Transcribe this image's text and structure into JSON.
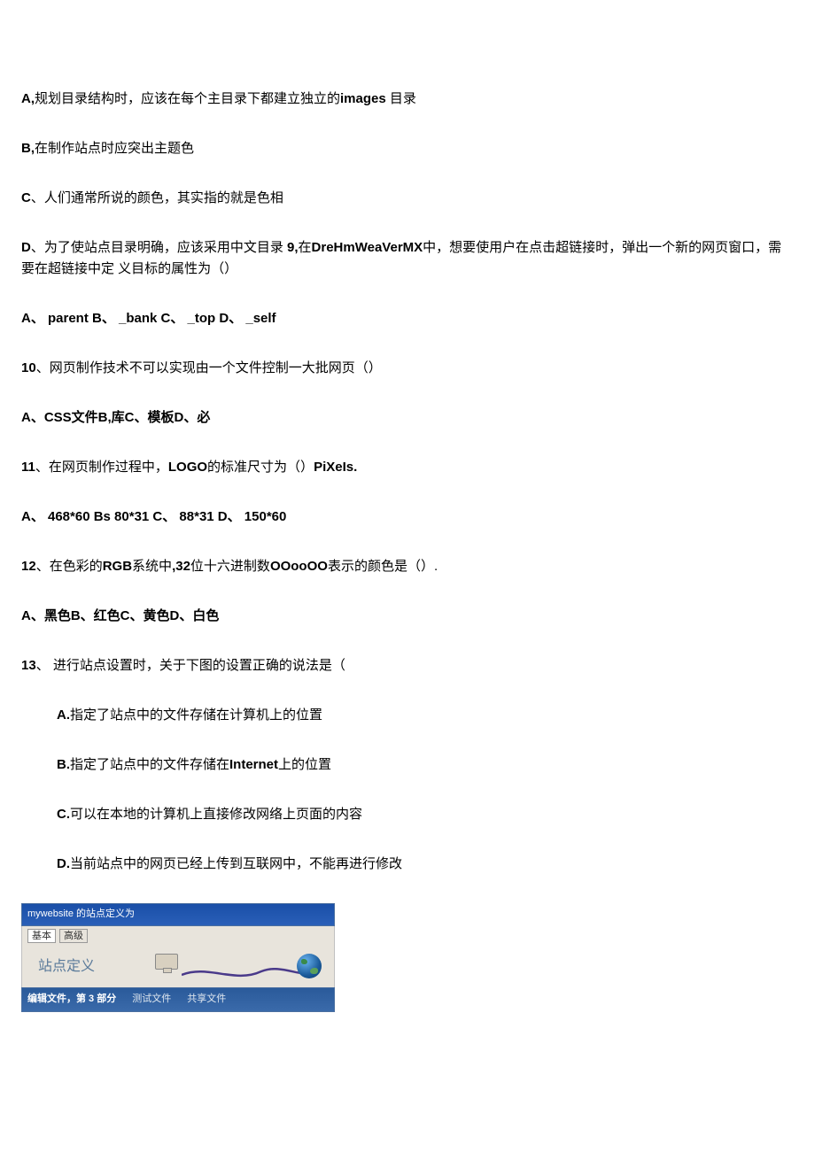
{
  "items": [
    {
      "type": "option",
      "text": "A,规划目录结构时，应该在每个主目录下都建立独立的images 目录",
      "boldParts": [
        "A,",
        "images"
      ]
    },
    {
      "type": "option",
      "text": "B,在制作站点时应突出主题色",
      "boldParts": [
        "B,"
      ]
    },
    {
      "type": "option",
      "text": "C、人们通常所说的颜色，其实指的就是色相",
      "boldParts": [
        "C"
      ]
    },
    {
      "type": "option-multi",
      "text": "D、为了使站点目录明确，应该采用中文目录 9,在DreHmWeaVerMX中，想要使用户在点击超链接时，弹出一个新的网页窗口，需要在超链接中定 义目标的属性为（）"
    },
    {
      "type": "bold-line",
      "text": "A、 parent B、 _bank C、 _top D、 _self"
    },
    {
      "type": "question",
      "text": "10、网页制作技术不可以实现由一个文件控制一大批网页（）"
    },
    {
      "type": "bold-line",
      "text": "A、CSS文件B,库C、模板D、必"
    },
    {
      "type": "question",
      "text": "11、在网页制作过程中，LOGO的标准尺寸为（）PiXeIs."
    },
    {
      "type": "bold-line",
      "text": "A、 468*60 Bs 80*31 C、 88*31 D、 150*60"
    },
    {
      "type": "question",
      "text": "12、在色彩的RGB系统中,32位十六进制数OOooOO表示的颜色是（）."
    },
    {
      "type": "bold-line",
      "text": "A、黑色B、红色C、黄色D、白色"
    },
    {
      "type": "question",
      "text": "13、 进行站点设置时，关于下图的设置正确的说法是（"
    },
    {
      "type": "sub-option",
      "text": "A.指定了站点中的文件存储在计算机上的位置"
    },
    {
      "type": "sub-option",
      "text": "B.指定了站点中的文件存储在Internet上的位置"
    },
    {
      "type": "sub-option",
      "text": "C.可以在本地的计算机上直接修改网络上页面的内容"
    },
    {
      "type": "sub-option",
      "text": "D.当前站点中的网页已经上传到互联网中，不能再进行修改"
    }
  ],
  "screenshot": {
    "titlebar": "mywebsite 的站点定义为",
    "tab1": "基本",
    "tab2": "高级",
    "body_label": "站点定义",
    "footer1": "编辑文件，第 3  部分",
    "footer2": "测试文件",
    "footer3": "共享文件"
  }
}
